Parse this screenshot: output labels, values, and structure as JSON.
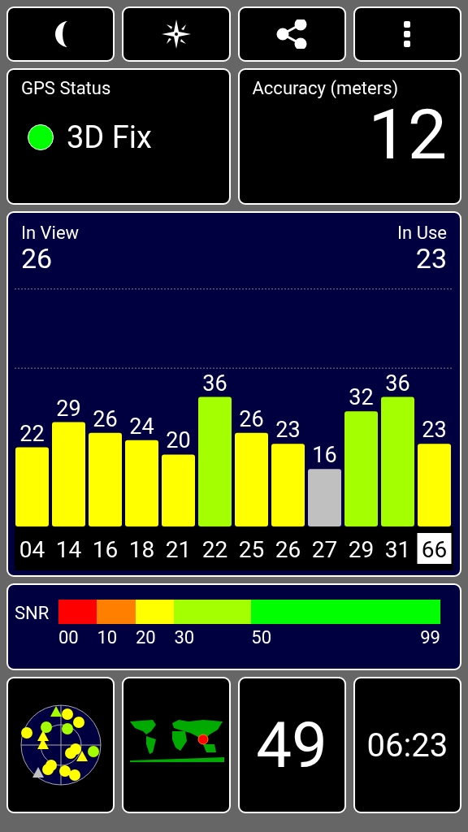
{
  "toolbar": {
    "buttons": [
      {
        "kind": "moon"
      },
      {
        "kind": "compass"
      },
      {
        "kind": "share"
      },
      {
        "kind": "menu"
      }
    ]
  },
  "gps_status": {
    "title": "GPS Status",
    "value": "3D Fix",
    "color": "#00ff00"
  },
  "accuracy": {
    "title": "Accuracy (meters)",
    "value": "12"
  },
  "satellites": {
    "in_view_label": "In View",
    "in_view": "26",
    "in_use_label": "In Use",
    "in_use": "23",
    "id_states": [
      {
        "selected": false
      },
      {
        "selected": false
      },
      {
        "selected": false
      },
      {
        "selected": false
      },
      {
        "selected": false
      },
      {
        "selected": false
      },
      {
        "selected": false
      },
      {
        "selected": false
      },
      {
        "selected": false
      },
      {
        "selected": false
      },
      {
        "selected": false
      },
      {
        "selected": true
      }
    ],
    "chart_data": {
      "type": "bar",
      "data_labels": true,
      "categories": [
        "04",
        "14",
        "16",
        "18",
        "21",
        "22",
        "25",
        "26",
        "27",
        "29",
        "31",
        "66"
      ],
      "series": [
        {
          "colors": [
            "#ffff00",
            "#ffff00",
            "#ffff00",
            "#ffff00",
            "#ffff00",
            "#a4ff00",
            "#ffff00",
            "#ffff00",
            null,
            "#a4ff00",
            "#a4ff00",
            "#ffff00"
          ],
          "values": [
            22,
            29,
            26,
            24,
            20,
            36,
            26,
            23,
            null,
            32,
            36,
            23
          ]
        },
        {
          "color": "#c0c0c0",
          "values": [
            null,
            null,
            null,
            null,
            null,
            null,
            null,
            null,
            16,
            null,
            null,
            null
          ]
        }
      ]
    }
  },
  "snr_legend": {
    "title": "SNR",
    "segments": [
      {
        "label": "00",
        "color": "#ff0000"
      },
      {
        "label": "10",
        "color": "#ff8000"
      },
      {
        "label": "20",
        "color": "#ffff00"
      },
      {
        "label": "30",
        "color": "#a4ff00"
      },
      {
        "label": "50",
        "color": "#00ff00"
      }
    ],
    "end_label": "99"
  },
  "tiles": {
    "satellite_count": "49",
    "time": "06:23"
  }
}
